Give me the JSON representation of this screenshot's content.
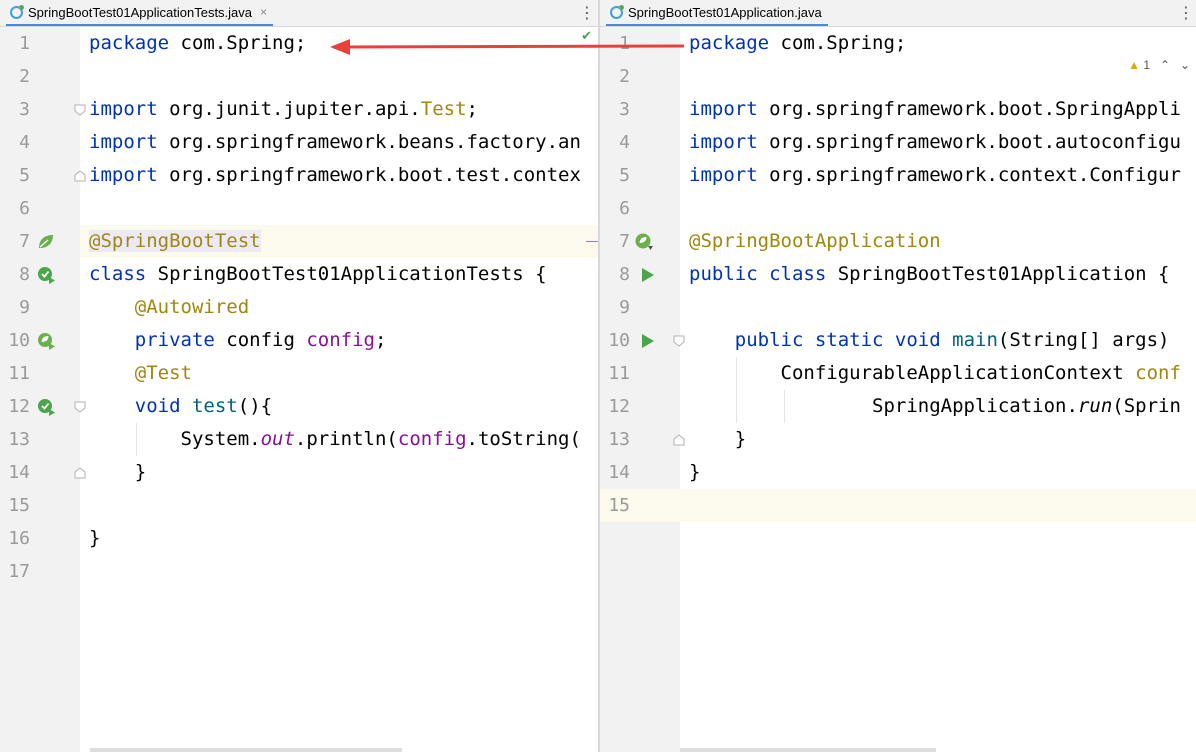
{
  "left_editor": {
    "tab": {
      "file_name": "SpringBootTest01ApplicationTests.java",
      "close": "×",
      "icon": "java-class-icon"
    },
    "more_menu": "⋮",
    "status_ok": "✔",
    "line_numbers": [
      "1",
      "2",
      "3",
      "4",
      "5",
      "6",
      "7",
      "8",
      "9",
      "10",
      "11",
      "12",
      "13",
      "14",
      "15",
      "16",
      "17"
    ],
    "code": {
      "l1": {
        "kw": "package",
        "rest": " com.Spring;"
      },
      "l3": {
        "kw": "import",
        "rest": " org.junit.jupiter.api.",
        "cls": "Test",
        "end": ";"
      },
      "l4": {
        "kw": "import",
        "rest": " org.springframework.beans.factory.an"
      },
      "l5": {
        "kw": "import",
        "rest": " org.springframework.boot.test.contex"
      },
      "l7": {
        "ann": "@SpringBootTest"
      },
      "l8": {
        "kw": "class",
        "rest": " SpringBootTest01ApplicationTests {"
      },
      "l9": {
        "ann": "@Autowired"
      },
      "l10": {
        "kw": "private",
        "type": " config ",
        "fld": "config",
        "end": ";"
      },
      "l11": {
        "ann": "@Test"
      },
      "l12": {
        "kw": "void",
        "sp": " ",
        "mth": "test",
        "end": "(){"
      },
      "l13": {
        "a": "System.",
        "fld": "out",
        "b": ".println(",
        "fld2": "config",
        "c": ".toString("
      },
      "l14": {
        "brace": "}"
      },
      "l16": {
        "brace": "}"
      }
    }
  },
  "right_editor": {
    "tab": {
      "file_name": "SpringBootTest01Application.java",
      "icon": "java-class-icon"
    },
    "more_menu": "⋮",
    "warning_count": "1",
    "inspection_nav_up": "⌃",
    "inspection_nav_down": "⌄",
    "line_numbers": [
      "1",
      "2",
      "3",
      "4",
      "5",
      "6",
      "7",
      "8",
      "9",
      "10",
      "11",
      "12",
      "13",
      "14",
      "15"
    ],
    "code": {
      "l1": {
        "kw": "package",
        "rest": " com.Spring;"
      },
      "l3": {
        "kw": "import",
        "rest": " org.springframework.boot.SpringAppli"
      },
      "l4": {
        "kw": "import",
        "rest": " org.springframework.boot.autoconfigu"
      },
      "l5": {
        "kw": "import",
        "rest": " org.springframework.context.Configur"
      },
      "l7": {
        "ann": "@SpringBootApplication"
      },
      "l8": {
        "kw": "public class",
        "rest": " SpringBootTest01Application {"
      },
      "l10": {
        "kw": "public static void",
        "sp": " ",
        "mth": "main",
        "rest": "(String[] args)"
      },
      "l11": {
        "rest": "ConfigurableApplicationContext ",
        "fld": "conf"
      },
      "l12": {
        "a": "SpringApplication.",
        "itl": "run",
        "b": "(Sprin"
      },
      "l13": {
        "brace": "}"
      },
      "l14": {
        "brace": "}"
      }
    }
  },
  "colors": {
    "keyword": "#0033b3",
    "annotation": "#9e880d",
    "field": "#871094",
    "method": "#00627a",
    "arrow": "#e8403a",
    "run_green": "#4aa64a"
  }
}
